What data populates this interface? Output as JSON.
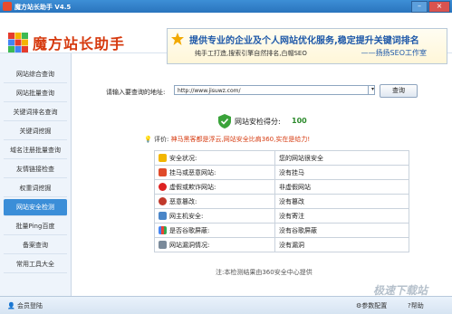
{
  "titlebar": {
    "title": "魔方站长助手  V4.5"
  },
  "header": {
    "logo_text": "魔方站长助手",
    "banner_line1": "提供专业的企业及个人网站优化服务,稳定提升关键词排名",
    "banner_line2": "纯手工打造,搜索引擎自然排名,白帽SEO",
    "banner_line3": "——扬扬SEO工作室"
  },
  "sidebar": {
    "items": [
      {
        "label": "网站综合查询"
      },
      {
        "label": "网站批量查询"
      },
      {
        "label": "关键词排名查询"
      },
      {
        "label": "关键词挖掘"
      },
      {
        "label": "域名注册批量查询"
      },
      {
        "label": "友情链接检查"
      },
      {
        "label": "权重词挖掘"
      },
      {
        "label": "网站安全检测"
      },
      {
        "label": "批量Ping百度"
      },
      {
        "label": "备案查询"
      },
      {
        "label": "常用工具大全"
      }
    ],
    "active_index": 7
  },
  "search": {
    "label": "请输入要查询的地址:",
    "value": "http://www.jisuwz.com/",
    "button": "查询"
  },
  "result": {
    "score_label": "网站安检得分:",
    "score": "100",
    "eval_key": "评价:",
    "eval_value": "神马黑客都是浮云,网站安全比肩360,实在是给力!",
    "rows": [
      {
        "name": "安全状况:",
        "value": "您的网站很安全"
      },
      {
        "name": "挂马或恶意网站:",
        "value": "没有挂马"
      },
      {
        "name": "虚假或欺诈网站:",
        "value": "非虚假网站"
      },
      {
        "name": "恶意篡改:",
        "value": "没有篡改"
      },
      {
        "name": "网主机安全:",
        "value": "没有寄注"
      },
      {
        "name": "是否谷歌屏蔽:",
        "value": "没有谷歌屏蔽"
      },
      {
        "name": "网站漏洞情况:",
        "value": "没有漏洞"
      }
    ],
    "note": "注:本检测结果由360安全中心提供"
  },
  "status": {
    "user": "会员登陆",
    "config": "参数配置",
    "help": "帮助"
  },
  "watermark": "极速下载站",
  "colors": {
    "accent": "#3b8ed8",
    "warn": "#d63a0f",
    "good": "#2c8a2c"
  }
}
